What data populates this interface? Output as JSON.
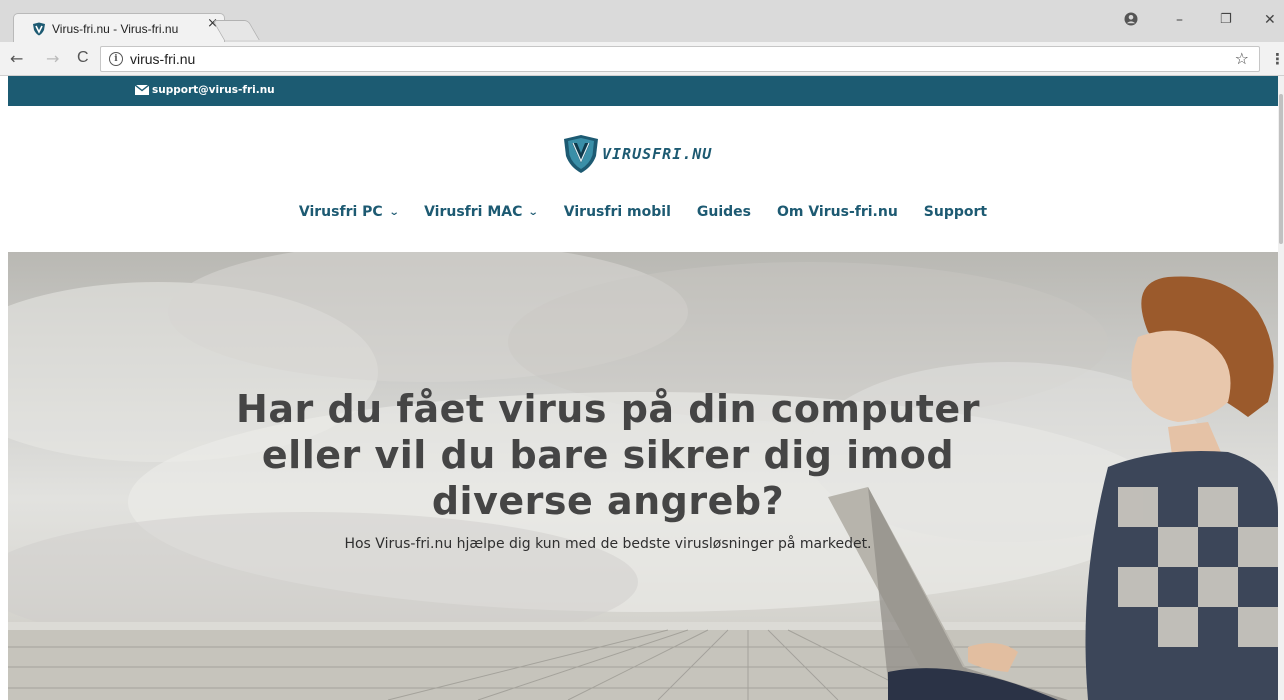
{
  "browser": {
    "tab_title": "Virus-fri.nu - Virus-fri.nu",
    "tab_close": "×",
    "url": "virus-fri.nu",
    "back": "←",
    "forward": "→",
    "reload": "C",
    "bookmark": "☆",
    "menu": "⋮",
    "window_controls": {
      "profile": "●",
      "minimize": "–",
      "restore": "❐",
      "close": "✕"
    }
  },
  "topbar": {
    "email": "support@virus-fri.nu"
  },
  "logo": {
    "text": "VIRUSFRI.NU",
    "colors": {
      "primary": "#1d5a72",
      "accent": "#3a8fa8"
    }
  },
  "nav": {
    "items": [
      {
        "label": "Virusfri PC",
        "dropdown": true
      },
      {
        "label": "Virusfri MAC",
        "dropdown": true
      },
      {
        "label": "Virusfri mobil",
        "dropdown": false
      },
      {
        "label": "Guides",
        "dropdown": false
      },
      {
        "label": "Om Virus-fri.nu",
        "dropdown": false
      },
      {
        "label": "Support",
        "dropdown": false
      }
    ],
    "chevron": "⌄"
  },
  "hero": {
    "title": "Har du fået virus på din computer eller vil du bare sikrer dig imod diverse angreb?",
    "subtitle": "Hos Virus-fri.nu hjælpe dig kun med de bedste virusløsninger på markedet."
  },
  "colors": {
    "topbar": "#1c5b72",
    "nav_text": "#1d5a72",
    "hero_title": "#454545"
  }
}
